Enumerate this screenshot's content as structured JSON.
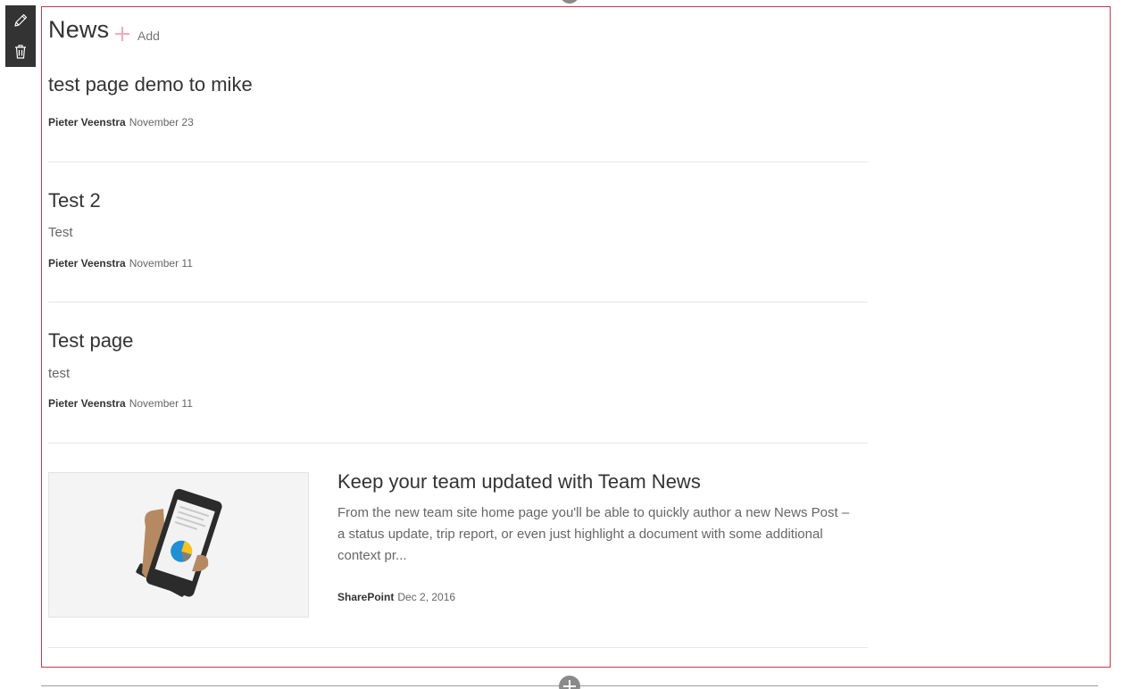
{
  "toolbar": {
    "edit_icon": "pencil-icon",
    "delete_icon": "trash-icon"
  },
  "webpart": {
    "title": "News",
    "add_label": "Add",
    "accent_color": "#c23a4a"
  },
  "news": [
    {
      "title": "test page demo to mike",
      "description": "",
      "author": "Pieter Veenstra",
      "date": "November 23"
    },
    {
      "title": "Test 2",
      "description": "Test",
      "author": "Pieter Veenstra",
      "date": "November 11"
    },
    {
      "title": "Test page",
      "description": "test",
      "author": "Pieter Veenstra",
      "date": "November 11"
    }
  ],
  "featured": {
    "title": "Keep your team updated with Team News",
    "description": "From the new team site home page you'll be able to quickly author a new News Post – a status update, trip report, or even just highlight a document with some additional context pr...",
    "author": "SharePoint",
    "date": "Dec 2, 2016",
    "image_icon": "phone-chart-illustration"
  }
}
